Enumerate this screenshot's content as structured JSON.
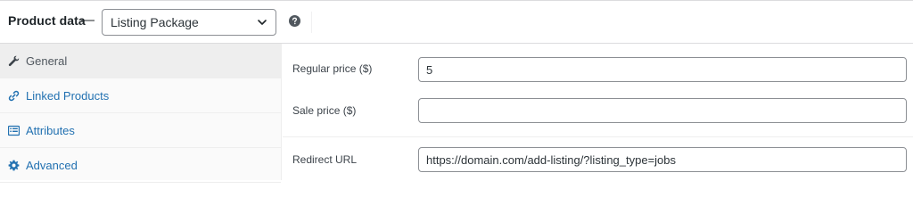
{
  "header": {
    "title": "Product data",
    "dash": "—",
    "product_type": "Listing Package",
    "help_icon": "help-circle-icon",
    "chevron_icon": "chevron-down-icon"
  },
  "tabs": [
    {
      "label": "General",
      "icon": "wrench-icon",
      "active": true
    },
    {
      "label": "Linked Products",
      "icon": "link-icon",
      "active": false
    },
    {
      "label": "Attributes",
      "icon": "list-icon",
      "active": false
    },
    {
      "label": "Advanced",
      "icon": "gear-icon",
      "active": false
    }
  ],
  "fields": {
    "regular_price": {
      "label": "Regular price ($)",
      "value": "5"
    },
    "sale_price": {
      "label": "Sale price ($)",
      "value": ""
    },
    "redirect_url": {
      "label": "Redirect URL",
      "value": "https://domain.com/add-listing/?listing_type=jobs"
    }
  },
  "colors": {
    "link": "#2271b1",
    "text": "#1d2327",
    "active_tab_bg": "#eeeeee",
    "sidebar_bg": "#fafafa",
    "border": "#8c8f94"
  }
}
